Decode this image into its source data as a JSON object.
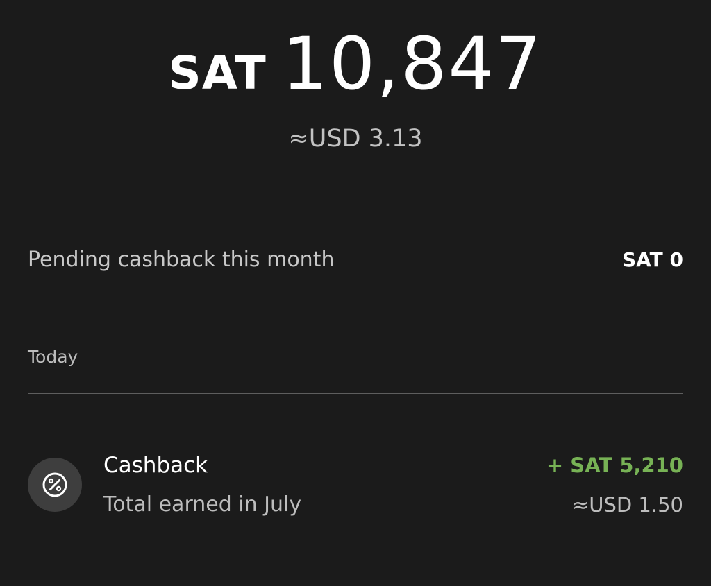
{
  "balance": {
    "unit": "SAT",
    "amount": "10,847",
    "fiat": "≈USD 3.13"
  },
  "pending": {
    "label": "Pending cashback this month",
    "value": "SAT 0"
  },
  "sections": [
    {
      "header": "Today",
      "transactions": [
        {
          "icon": "percent-icon",
          "title": "Cashback",
          "subtitle": "Total earned in July",
          "amount": "+ SAT 5,210",
          "fiat": "≈USD 1.50"
        }
      ]
    }
  ],
  "colors": {
    "background": "#1b1b1b",
    "positive_amount": "#77b255",
    "icon_bg": "#3e3e3e"
  }
}
